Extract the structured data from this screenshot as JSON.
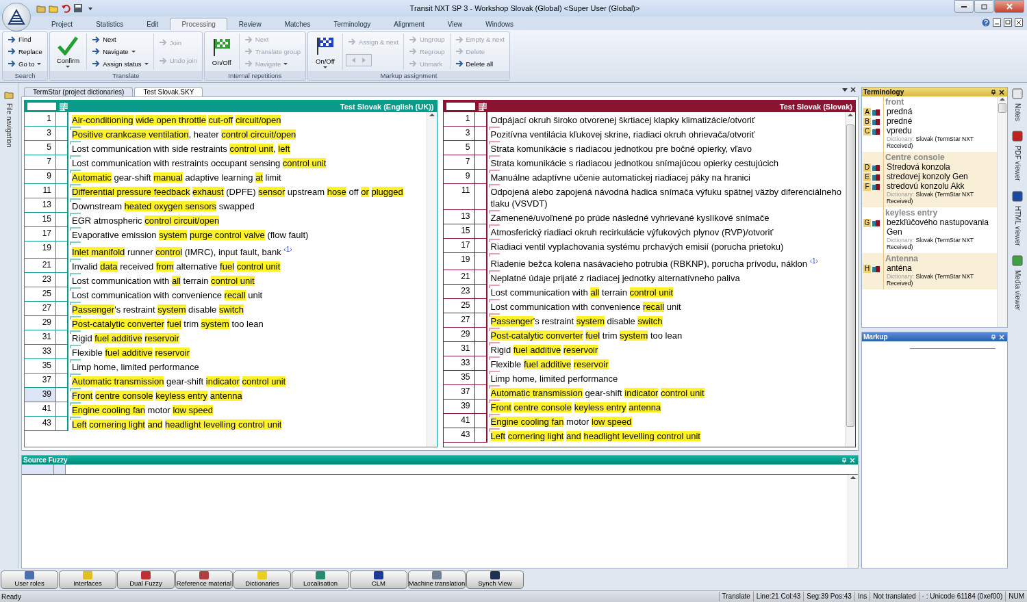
{
  "window": {
    "title": "Transit NXT SP 3 - Workshop Slovak (Global) <Super User (Global)>"
  },
  "ribbon_tabs": [
    {
      "label": "Project",
      "selected": false
    },
    {
      "label": "Statistics",
      "selected": false
    },
    {
      "label": "Edit",
      "selected": false
    },
    {
      "label": "Processing",
      "selected": true
    },
    {
      "label": "Review",
      "selected": false
    },
    {
      "label": "Matches",
      "selected": false
    },
    {
      "label": "Terminology",
      "selected": false
    },
    {
      "label": "Alignment",
      "selected": false
    },
    {
      "label": "View",
      "selected": false
    },
    {
      "label": "Windows",
      "selected": false
    }
  ],
  "ribbon_groups": [
    {
      "label": "Search",
      "columns": [
        [
          {
            "kind": "small",
            "label": "Find",
            "disabled": false,
            "dropdown": false
          },
          {
            "kind": "small",
            "label": "Replace",
            "disabled": false,
            "dropdown": false
          },
          {
            "kind": "small",
            "label": "Go to",
            "disabled": false,
            "dropdown": true
          }
        ]
      ]
    },
    {
      "label": "Translate",
      "columns": [
        [
          {
            "kind": "large",
            "label": "Confirm",
            "disabled": false,
            "dropdown": true
          }
        ],
        [
          {
            "kind": "small",
            "label": "Next",
            "disabled": false,
            "dropdown": false
          },
          {
            "kind": "small",
            "label": "Navigate",
            "disabled": false,
            "dropdown": true
          },
          {
            "kind": "small",
            "label": "Assign status",
            "disabled": false,
            "dropdown": true
          }
        ],
        [
          {
            "kind": "small",
            "label": "Join",
            "disabled": true,
            "dropdown": false
          },
          {
            "kind": "small",
            "label": "Undo join",
            "disabled": true,
            "dropdown": false
          }
        ]
      ]
    },
    {
      "label": "Internal repetitions",
      "columns": [
        [
          {
            "kind": "large",
            "label": "On/Off",
            "disabled": false,
            "dropdown": false
          }
        ],
        [
          {
            "kind": "small",
            "label": "Next",
            "disabled": true,
            "dropdown": false
          },
          {
            "kind": "small",
            "label": "Translate group",
            "disabled": true,
            "dropdown": false
          },
          {
            "kind": "small",
            "label": "Navigate",
            "disabled": true,
            "dropdown": true
          }
        ]
      ]
    },
    {
      "label": "Markup assignment",
      "columns": [
        [
          {
            "kind": "large",
            "label": "On/Off",
            "disabled": false,
            "dropdown": true
          }
        ],
        [
          {
            "kind": "small",
            "label": "Assign & next",
            "disabled": true,
            "dropdown": false
          },
          {
            "kind": "arrows",
            "disabled": true
          }
        ],
        [
          {
            "kind": "small",
            "label": "Ungroup",
            "disabled": true,
            "dropdown": false
          },
          {
            "kind": "small",
            "label": "Regroup",
            "disabled": true,
            "dropdown": false
          },
          {
            "kind": "small",
            "label": "Unmark",
            "disabled": true,
            "dropdown": false
          }
        ],
        [
          {
            "kind": "small",
            "label": "Empty & next",
            "disabled": true,
            "dropdown": false
          },
          {
            "kind": "small",
            "label": "Delete",
            "disabled": true,
            "dropdown": false
          },
          {
            "kind": "small",
            "label": "Delete all",
            "disabled": false,
            "dropdown": false
          }
        ]
      ]
    }
  ],
  "left_sidebar": {
    "label": "File navigation"
  },
  "document_tabs": [
    {
      "label": "TermStar (project dictionaries)",
      "selected": false
    },
    {
      "label": "Test Slovak.SKY",
      "selected": true
    }
  ],
  "source_pane": {
    "title": "Test Slovak (English (UK))",
    "rows": [
      {
        "number": "1",
        "selected": false,
        "marked": false,
        "parts": [
          {
            "kind": "term",
            "text": "Air-conditioning "
          },
          {
            "kind": "term",
            "text": "wide open throttle "
          },
          {
            "kind": "term",
            "text": "cut-off "
          },
          {
            "kind": "term",
            "text": "circuit/open"
          }
        ]
      },
      {
        "number": "3",
        "selected": false,
        "marked": true,
        "parts": [
          {
            "kind": "term",
            "text": "Positive crankcase ventilation"
          },
          {
            "kind": "plain",
            "text": ", heater "
          },
          {
            "kind": "term",
            "text": "control circuit/open"
          }
        ]
      },
      {
        "number": "5",
        "selected": false,
        "marked": true,
        "parts": [
          {
            "kind": "plain",
            "text": "Lost communication with side restraints "
          },
          {
            "kind": "term",
            "text": "control unit"
          },
          {
            "kind": "plain",
            "text": ", "
          },
          {
            "kind": "term",
            "text": "left"
          }
        ]
      },
      {
        "number": "7",
        "selected": false,
        "marked": true,
        "parts": [
          {
            "kind": "plain",
            "text": "Lost communication with restraints occupant sensing "
          },
          {
            "kind": "term",
            "text": "control unit"
          }
        ]
      },
      {
        "number": "9",
        "selected": false,
        "marked": true,
        "parts": [
          {
            "kind": "term",
            "text": "Automatic"
          },
          {
            "kind": "plain",
            "text": " gear-shift "
          },
          {
            "kind": "term",
            "text": "manual"
          },
          {
            "kind": "plain",
            "text": " adaptive learning "
          },
          {
            "kind": "term",
            "text": "at"
          },
          {
            "kind": "plain",
            "text": " limit"
          }
        ]
      },
      {
        "number": "11",
        "selected": false,
        "marked": true,
        "parts": [
          {
            "kind": "term",
            "text": "Differential pressure feedback "
          },
          {
            "kind": "term",
            "text": "exhaust"
          },
          {
            "kind": "plain",
            "text": " (DPFE) "
          },
          {
            "kind": "term",
            "text": "sensor"
          },
          {
            "kind": "plain",
            "text": " upstream "
          },
          {
            "kind": "term",
            "text": "hose"
          },
          {
            "kind": "plain",
            "text": " off "
          },
          {
            "kind": "term",
            "text": "or "
          },
          {
            "kind": "term",
            "text": "plugged"
          }
        ]
      },
      {
        "number": "13",
        "selected": false,
        "marked": true,
        "parts": [
          {
            "kind": "plain",
            "text": "Downstream "
          },
          {
            "kind": "term",
            "text": "heated oxygen sensors"
          },
          {
            "kind": "plain",
            "text": " swapped"
          }
        ]
      },
      {
        "number": "15",
        "selected": false,
        "marked": true,
        "parts": [
          {
            "kind": "plain",
            "text": "EGR atmospheric "
          },
          {
            "kind": "term",
            "text": "control circuit/open"
          }
        ]
      },
      {
        "number": "17",
        "selected": false,
        "marked": true,
        "parts": [
          {
            "kind": "plain",
            "text": "Evaporative emission "
          },
          {
            "kind": "term",
            "text": "system "
          },
          {
            "kind": "term",
            "text": "purge control valve"
          },
          {
            "kind": "plain",
            "text": " (flow fault)"
          }
        ]
      },
      {
        "number": "19",
        "selected": false,
        "marked": true,
        "parts": [
          {
            "kind": "term",
            "text": "Inlet manifold"
          },
          {
            "kind": "plain",
            "text": " runner "
          },
          {
            "kind": "term",
            "text": "control"
          },
          {
            "kind": "plain",
            "text": " (IMRC), input fault, bank "
          },
          {
            "kind": "tag",
            "text": "‹1›"
          }
        ]
      },
      {
        "number": "21",
        "selected": false,
        "marked": true,
        "parts": [
          {
            "kind": "plain",
            "text": "Invalid "
          },
          {
            "kind": "term",
            "text": "data"
          },
          {
            "kind": "plain",
            "text": " received "
          },
          {
            "kind": "term",
            "text": "from"
          },
          {
            "kind": "plain",
            "text": " alternative "
          },
          {
            "kind": "term",
            "text": "fuel "
          },
          {
            "kind": "term",
            "text": "control unit"
          }
        ]
      },
      {
        "number": "23",
        "selected": false,
        "marked": true,
        "parts": [
          {
            "kind": "plain",
            "text": "Lost communication with "
          },
          {
            "kind": "term",
            "text": "all"
          },
          {
            "kind": "plain",
            "text": " terrain "
          },
          {
            "kind": "term",
            "text": "control unit"
          }
        ]
      },
      {
        "number": "25",
        "selected": false,
        "marked": true,
        "parts": [
          {
            "kind": "plain",
            "text": "Lost communication with convenience "
          },
          {
            "kind": "term",
            "text": "recall"
          },
          {
            "kind": "plain",
            "text": " unit"
          }
        ]
      },
      {
        "number": "27",
        "selected": false,
        "marked": true,
        "parts": [
          {
            "kind": "term",
            "text": "Passenger"
          },
          {
            "kind": "plain",
            "text": "'s restraint "
          },
          {
            "kind": "term",
            "text": "system"
          },
          {
            "kind": "plain",
            "text": " disable "
          },
          {
            "kind": "term",
            "text": "switch"
          }
        ]
      },
      {
        "number": "29",
        "selected": false,
        "marked": true,
        "parts": [
          {
            "kind": "term",
            "text": "Post-catalytic converter "
          },
          {
            "kind": "term",
            "text": "fuel"
          },
          {
            "kind": "plain",
            "text": " trim "
          },
          {
            "kind": "term",
            "text": "system"
          },
          {
            "kind": "plain",
            "text": " too lean"
          }
        ]
      },
      {
        "number": "31",
        "selected": false,
        "marked": true,
        "parts": [
          {
            "kind": "plain",
            "text": "Rigid "
          },
          {
            "kind": "term",
            "text": "fuel additive "
          },
          {
            "kind": "term",
            "text": "reservoir"
          }
        ]
      },
      {
        "number": "33",
        "selected": false,
        "marked": true,
        "parts": [
          {
            "kind": "plain",
            "text": "Flexible "
          },
          {
            "kind": "term",
            "text": "fuel additive "
          },
          {
            "kind": "term",
            "text": "reservoir"
          }
        ]
      },
      {
        "number": "35",
        "selected": false,
        "marked": true,
        "parts": [
          {
            "kind": "plain",
            "text": "Limp home, limited performance"
          }
        ]
      },
      {
        "number": "37",
        "selected": false,
        "marked": true,
        "parts": [
          {
            "kind": "term",
            "text": "Automatic transmission"
          },
          {
            "kind": "plain",
            "text": " gear-shift "
          },
          {
            "kind": "term",
            "text": "indicator "
          },
          {
            "kind": "term",
            "text": "control unit"
          }
        ]
      },
      {
        "number": "39",
        "selected": true,
        "marked": true,
        "parts": [
          {
            "kind": "term",
            "text": "Front "
          },
          {
            "kind": "term",
            "text": "centre console "
          },
          {
            "kind": "term",
            "text": "keyless entry "
          },
          {
            "kind": "term",
            "text": "antenna"
          }
        ]
      },
      {
        "number": "41",
        "selected": false,
        "marked": true,
        "parts": [
          {
            "kind": "term",
            "text": "Engine cooling fan"
          },
          {
            "kind": "plain",
            "text": " motor "
          },
          {
            "kind": "term",
            "text": "low speed"
          }
        ]
      },
      {
        "number": "43",
        "selected": false,
        "marked": true,
        "parts": [
          {
            "kind": "term",
            "text": "Left "
          },
          {
            "kind": "term",
            "text": "cornering light "
          },
          {
            "kind": "term",
            "text": "and "
          },
          {
            "kind": "term",
            "text": "headlight levelling control unit"
          }
        ]
      }
    ]
  },
  "target_pane": {
    "title": "Test Slovak (Slovak)",
    "rows": [
      {
        "number": "1",
        "selected": false,
        "marked": false,
        "parts": [
          {
            "kind": "plain",
            "text": "Odpájací okruh široko otvorenej škrtiacej klapky klimatizácie/otvoriť"
          }
        ]
      },
      {
        "number": "3",
        "selected": false,
        "marked": true,
        "parts": [
          {
            "kind": "plain",
            "text": "Pozitívna ventilácia kľukovej skrine, riadiaci okruh ohrievača/otvoriť"
          }
        ]
      },
      {
        "number": "5",
        "selected": false,
        "marked": true,
        "parts": [
          {
            "kind": "plain",
            "text": "Strata komunikácie s riadiacou jednotkou pre bočné opierky, vľavo"
          }
        ]
      },
      {
        "number": "7",
        "selected": false,
        "marked": true,
        "parts": [
          {
            "kind": "plain",
            "text": "Strata komunikácie s riadiacou jednotkou snímajúcou opierky cestujúcich"
          }
        ]
      },
      {
        "number": "9",
        "selected": false,
        "marked": true,
        "parts": [
          {
            "kind": "plain",
            "text": "Manuálne adaptívne učenie automatickej riadiacej páky na hranici"
          }
        ]
      },
      {
        "number": "11",
        "selected": false,
        "marked": true,
        "parts": [
          {
            "kind": "plain",
            "text": "Odpojená alebo zapojená návodná hadica snímača výfuku spätnej väzby diferenciálneho tlaku (VSVDT)"
          }
        ]
      },
      {
        "number": "13",
        "selected": false,
        "marked": true,
        "parts": [
          {
            "kind": "plain",
            "text": "Zamenené/uvoľnené po prúde následné vyhrievané kyslíkové snímače"
          }
        ]
      },
      {
        "number": "15",
        "selected": false,
        "marked": true,
        "parts": [
          {
            "kind": "plain",
            "text": "Atmosferický riadiaci okruh recirkulácie výfukových plynov (RVP)/otvoriť"
          }
        ]
      },
      {
        "number": "17",
        "selected": false,
        "marked": true,
        "parts": [
          {
            "kind": "plain",
            "text": "Riadiaci ventil vyplachovania systému prchavých emisií (porucha prietoku)"
          }
        ]
      },
      {
        "number": "19",
        "selected": false,
        "marked": true,
        "parts": [
          {
            "kind": "plain",
            "text": "Riadenie bežca kolena nasávacieho potrubia (RBKNP), porucha prívodu, náklon "
          },
          {
            "kind": "tag",
            "text": "‹1›"
          }
        ]
      },
      {
        "number": "21",
        "selected": false,
        "marked": true,
        "parts": [
          {
            "kind": "plain",
            "text": "Neplatné údaje prijaté z riadiacej jednotky alternatívneho paliva"
          }
        ]
      },
      {
        "number": "23",
        "selected": false,
        "marked": true,
        "parts": [
          {
            "kind": "plain",
            "text": "Lost communication with "
          },
          {
            "kind": "term",
            "text": "all"
          },
          {
            "kind": "plain",
            "text": " terrain "
          },
          {
            "kind": "term",
            "text": "control unit"
          }
        ]
      },
      {
        "number": "25",
        "selected": false,
        "marked": true,
        "parts": [
          {
            "kind": "plain",
            "text": "Lost communication with convenience "
          },
          {
            "kind": "term",
            "text": "recall"
          },
          {
            "kind": "plain",
            "text": " unit"
          }
        ]
      },
      {
        "number": "27",
        "selected": false,
        "marked": true,
        "parts": [
          {
            "kind": "term",
            "text": "Passenger"
          },
          {
            "kind": "plain",
            "text": "'s restraint "
          },
          {
            "kind": "term",
            "text": "system"
          },
          {
            "kind": "plain",
            "text": " disable "
          },
          {
            "kind": "term",
            "text": "switch"
          }
        ]
      },
      {
        "number": "29",
        "selected": false,
        "marked": true,
        "parts": [
          {
            "kind": "term",
            "text": "Post-catalytic converter "
          },
          {
            "kind": "term",
            "text": "fuel"
          },
          {
            "kind": "plain",
            "text": " trim "
          },
          {
            "kind": "term",
            "text": "system"
          },
          {
            "kind": "plain",
            "text": " too lean"
          }
        ]
      },
      {
        "number": "31",
        "selected": false,
        "marked": true,
        "parts": [
          {
            "kind": "plain",
            "text": "Rigid "
          },
          {
            "kind": "term",
            "text": "fuel additive "
          },
          {
            "kind": "term",
            "text": "reservoir"
          }
        ]
      },
      {
        "number": "33",
        "selected": false,
        "marked": true,
        "parts": [
          {
            "kind": "plain",
            "text": "Flexible "
          },
          {
            "kind": "term",
            "text": "fuel additive "
          },
          {
            "kind": "term",
            "text": "reservoir"
          }
        ]
      },
      {
        "number": "35",
        "selected": false,
        "marked": true,
        "parts": [
          {
            "kind": "plain",
            "text": "Limp home, limited performance"
          }
        ]
      },
      {
        "number": "37",
        "selected": false,
        "marked": true,
        "parts": [
          {
            "kind": "term",
            "text": "Automatic transmission"
          },
          {
            "kind": "plain",
            "text": " gear-shift "
          },
          {
            "kind": "term",
            "text": "indicator "
          },
          {
            "kind": "term",
            "text": "control unit"
          }
        ]
      },
      {
        "number": "39",
        "selected": false,
        "marked": true,
        "parts": [
          {
            "kind": "term",
            "text": "Front "
          },
          {
            "kind": "term",
            "text": "centre console "
          },
          {
            "kind": "term",
            "text": "keyless entry "
          },
          {
            "kind": "term",
            "text": "antenna"
          }
        ]
      },
      {
        "number": "41",
        "selected": false,
        "marked": true,
        "parts": [
          {
            "kind": "term",
            "text": "Engine cooling fan"
          },
          {
            "kind": "plain",
            "text": " motor "
          },
          {
            "kind": "term",
            "text": "low speed"
          }
        ]
      },
      {
        "number": "43",
        "selected": false,
        "marked": true,
        "parts": [
          {
            "kind": "term",
            "text": "Left "
          },
          {
            "kind": "term",
            "text": "cornering light "
          },
          {
            "kind": "term",
            "text": "and "
          },
          {
            "kind": "term",
            "text": "headlight levelling control unit"
          }
        ]
      }
    ]
  },
  "source_fuzzy": {
    "title": "Source Fuzzy"
  },
  "terminology": {
    "title": "Terminology",
    "entries": [
      {
        "term": "front",
        "translations": [
          {
            "letter": "A",
            "text": "predná"
          },
          {
            "letter": "B",
            "text": "predné"
          },
          {
            "letter": "C",
            "text": "vpredu"
          }
        ],
        "dictionary_label": "Dictionary:",
        "dictionary": "Slovak (TermStar NXT Received)"
      },
      {
        "term": "Centre console",
        "translations": [
          {
            "letter": "D",
            "text": "Stredová konzola"
          },
          {
            "letter": "E",
            "text": "stredovej konzoly Gen"
          },
          {
            "letter": "F",
            "text": "stredovú konzolu Akk"
          }
        ],
        "dictionary_label": "Dictionary:",
        "dictionary": "Slovak (TermStar NXT Received)"
      },
      {
        "term": "keyless entry",
        "translations": [
          {
            "letter": "G",
            "text": "bezkľúčového nastupovania Gen"
          }
        ],
        "dictionary_label": "Dictionary:",
        "dictionary": "Slovak (TermStar NXT Received)"
      },
      {
        "term": "Antenna",
        "translations": [
          {
            "letter": "H",
            "text": "anténa"
          }
        ],
        "dictionary_label": "Dictionary:",
        "dictionary": "Slovak (TermStar NXT Received)"
      }
    ]
  },
  "markup": {
    "title": "Markup"
  },
  "right_sidebar": [
    {
      "label": "Notes"
    },
    {
      "label": "PDF viewer"
    },
    {
      "label": "HTML viewer"
    },
    {
      "label": "Media viewer"
    }
  ],
  "bottom_buttons": [
    {
      "label": "User roles"
    },
    {
      "label": "Interfaces"
    },
    {
      "label": "Dual Fuzzy"
    },
    {
      "label": "Reference material"
    },
    {
      "label": "Dictionaries"
    },
    {
      "label": "Localisation"
    },
    {
      "label": "CLM"
    },
    {
      "label": "Machine translation"
    },
    {
      "label": "Synch View"
    }
  ],
  "status_bar": {
    "message": "Ready",
    "fields": [
      "Translate",
      "Line:21 Col:43",
      "Seg:39 Pos:43",
      "Ins",
      "Not translated",
      "· : Unicode 61184 (0xef00)",
      "NUM"
    ]
  }
}
